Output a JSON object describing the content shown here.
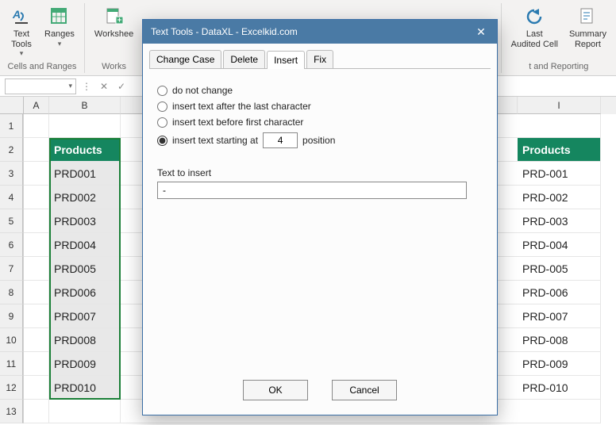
{
  "ribbon": {
    "buttons": {
      "text_tools": "Text\nTools",
      "ranges": "Ranges",
      "worksheet": "Workshee",
      "last_audited": "Last\nAudited Cell",
      "summary": "Summary\nReport"
    },
    "groups": {
      "cells_ranges": "Cells and Ranges",
      "works": "Works",
      "reporting": "t and Reporting"
    }
  },
  "formula_bar": {
    "x_btn": "✕",
    "check_btn": "✓",
    "dash": "⋮"
  },
  "grid": {
    "columns": [
      "A",
      "B",
      "I"
    ],
    "header_left": "Products",
    "header_right": "Products",
    "left": [
      "PRD001",
      "PRD002",
      "PRD003",
      "PRD004",
      "PRD005",
      "PRD006",
      "PRD007",
      "PRD008",
      "PRD009",
      "PRD010"
    ],
    "right": [
      "PRD-001",
      "PRD-002",
      "PRD-003",
      "PRD-004",
      "PRD-005",
      "PRD-006",
      "PRD-007",
      "PRD-008",
      "PRD-009",
      "PRD-010"
    ],
    "rownums": [
      "1",
      "2",
      "3",
      "4",
      "5",
      "6",
      "7",
      "8",
      "9",
      "10",
      "11",
      "12",
      "13"
    ]
  },
  "dialog": {
    "title": "Text Tools - DataXL - Excelkid.com",
    "tabs": [
      "Change Case",
      "Delete",
      "Insert",
      "Fix"
    ],
    "active_tab": "Insert",
    "options": {
      "no_change": "do not change",
      "after_last": "insert text after the last character",
      "before_first": "insert text before first character",
      "starting_at": "insert text starting at",
      "position_suffix": "position",
      "position_value": "4"
    },
    "text_label": "Text to insert",
    "text_value": "-",
    "ok": "OK",
    "cancel": "Cancel"
  }
}
